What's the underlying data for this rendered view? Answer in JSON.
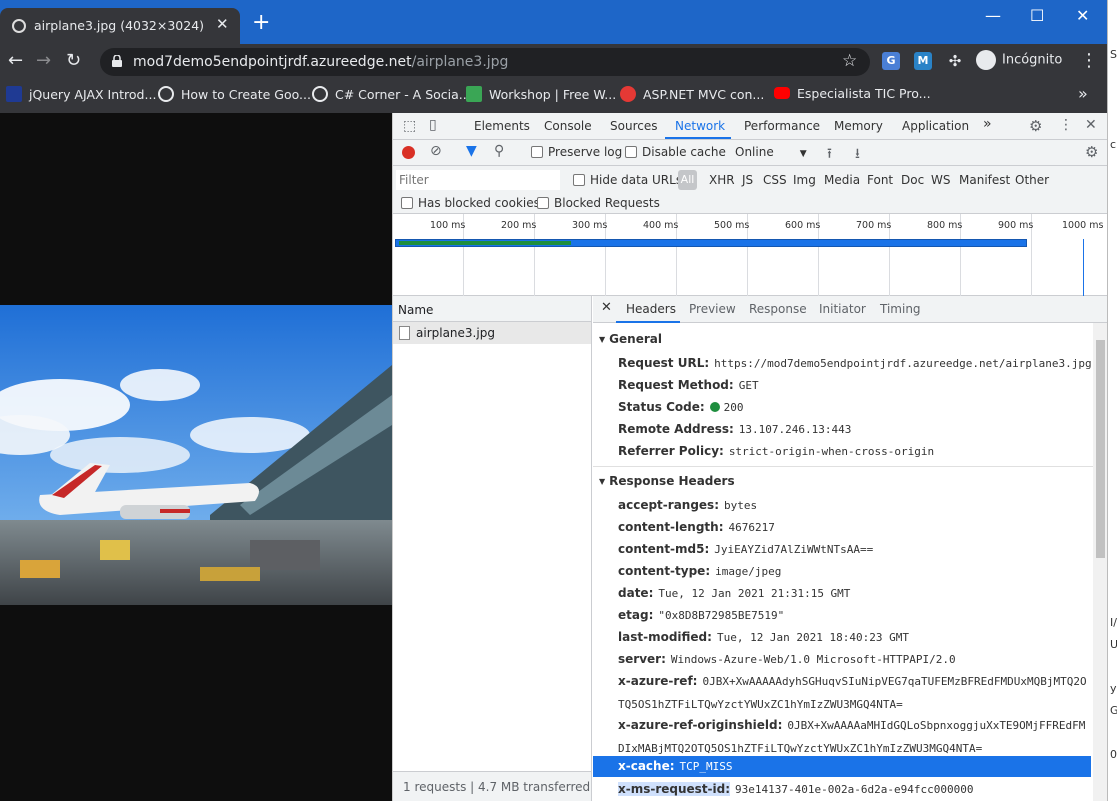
{
  "window": {
    "minimize": "—",
    "maximize": "☐",
    "close": "✕"
  },
  "tab": {
    "title": "airplane3.jpg (4032×3024)",
    "close": "✕",
    "new_tab": "+"
  },
  "toolbar": {
    "url_host": "mod7demo5endpointjrdf.azureedge.net",
    "url_path": "/airplane3.jpg",
    "incognito": "Incógnito"
  },
  "bookmarks": [
    {
      "label": "jQuery AJAX Introd...",
      "color": "#1f3a93"
    },
    {
      "label": "How to Create Goo...",
      "color": "#ffffff"
    },
    {
      "label": "C# Corner - A Socia...",
      "color": "#ffffff"
    },
    {
      "label": "Workshop | Free W...",
      "color": "#3aa655"
    },
    {
      "label": "ASP.NET MVC con...",
      "color": "#e53935"
    },
    {
      "label": "Especialista TIC Pro...",
      "color": "#ff0000"
    }
  ],
  "devtools": {
    "tabs": [
      "Elements",
      "Console",
      "Sources",
      "Network",
      "Performance",
      "Memory",
      "Application"
    ],
    "more": "»",
    "toolbar": {
      "preserve_log": "Preserve log",
      "disable_cache": "Disable cache",
      "throttle": "Online"
    },
    "filter": {
      "placeholder": "Filter",
      "hide_data_urls": "Hide data URLs",
      "all": "All",
      "types": [
        "XHR",
        "JS",
        "CSS",
        "Img",
        "Media",
        "Font",
        "Doc",
        "WS",
        "Manifest",
        "Other"
      ],
      "blocked_cookies": "Has blocked cookies",
      "blocked_requests": "Blocked Requests"
    },
    "timeline_ticks": [
      "100 ms",
      "200 ms",
      "300 ms",
      "400 ms",
      "500 ms",
      "600 ms",
      "700 ms",
      "800 ms",
      "900 ms",
      "1000 ms"
    ],
    "list": {
      "header": "Name",
      "rows": [
        "airplane3.jpg"
      ],
      "status": "1 requests  |  4.7 MB transferred"
    },
    "detail_tabs": [
      "Headers",
      "Preview",
      "Response",
      "Initiator",
      "Timing"
    ],
    "general": {
      "title": "General",
      "rows": [
        {
          "k": "Request URL:",
          "v": "https://mod7demo5endpointjrdf.azureedge.net/airplane3.jpg"
        },
        {
          "k": "Request Method:",
          "v": "GET"
        },
        {
          "k": "Status Code:",
          "v": "200"
        },
        {
          "k": "Remote Address:",
          "v": "13.107.246.13:443"
        },
        {
          "k": "Referrer Policy:",
          "v": "strict-origin-when-cross-origin"
        }
      ]
    },
    "response": {
      "title": "Response Headers",
      "rows": [
        {
          "k": "accept-ranges:",
          "v": "bytes"
        },
        {
          "k": "content-length:",
          "v": "4676217"
        },
        {
          "k": "content-md5:",
          "v": "JyiEAYZid7AlZiWWtNTsAA=="
        },
        {
          "k": "content-type:",
          "v": "image/jpeg"
        },
        {
          "k": "date:",
          "v": "Tue, 12 Jan 2021 21:31:15 GMT"
        },
        {
          "k": "etag:",
          "v": "\"0x8D8B72985BE7519\""
        },
        {
          "k": "last-modified:",
          "v": "Tue, 12 Jan 2021 18:40:23 GMT"
        },
        {
          "k": "server:",
          "v": "Windows-Azure-Web/1.0 Microsoft-HTTPAPI/2.0"
        },
        {
          "k": "x-azure-ref:",
          "v": "0JBX+XwAAAAAdyhSGHuqvSIuNipVEG7qaTUFEMzBFREdFMDUxMQBjMTQ2OTQ5OS1hZTFiLTQwYzctYWUxZC1hYmIzZWU3MGQ4NTA="
        },
        {
          "k": "x-azure-ref-originshield:",
          "v": "0JBX+XwAAAAaMHIdGQLoSbpnxoggjuXxTE9OMjFFREdFMDIxMABjMTQ2OTQ5OS1hZTFiLTQwYzctYWUxZC1hYmIzZWU3MGQ4NTA="
        },
        {
          "k": "x-cache:",
          "v": "TCP_MISS"
        },
        {
          "k": "x-ms-request-id:",
          "v": "93e14137-401e-002a-6d2a-e94fcc000000"
        }
      ]
    }
  },
  "edge_fragments": [
    "SN",
    "c",
    "I/",
    "U",
    "y4",
    "GC",
    "0("
  ]
}
